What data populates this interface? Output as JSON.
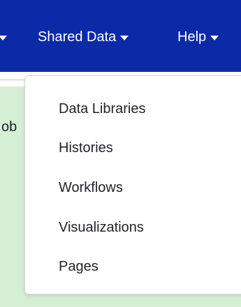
{
  "navbar": {
    "items": [
      {
        "label": ""
      },
      {
        "label": "Shared Data"
      },
      {
        "label": "Help"
      }
    ]
  },
  "main": {
    "clipped_text": "ob"
  },
  "dropdown": {
    "items": [
      {
        "label": "Data Libraries"
      },
      {
        "label": "Histories"
      },
      {
        "label": "Workflows"
      },
      {
        "label": "Visualizations"
      },
      {
        "label": "Pages"
      }
    ]
  },
  "colors": {
    "navbar": "#0a2aa8",
    "panel": "#d5efd5",
    "text": "#1f2329"
  }
}
